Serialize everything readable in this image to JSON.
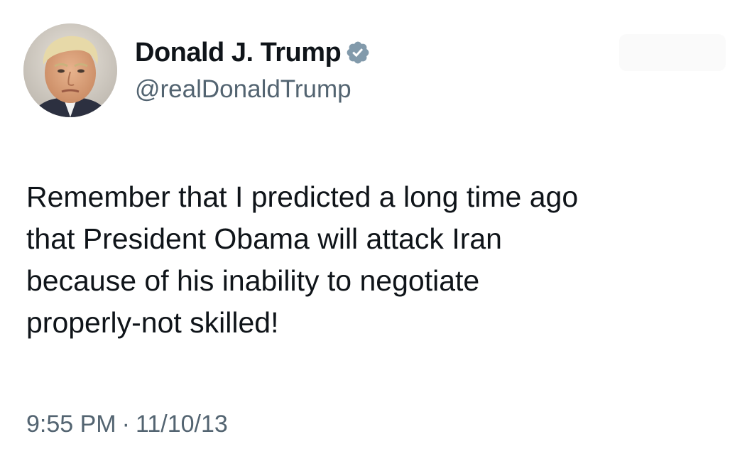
{
  "tweet": {
    "author": {
      "display_name": "Donald J. Trump",
      "handle": "@realDonaldTrump",
      "verified": true,
      "verified_icon": "verified-badge-icon",
      "verified_color": "#829aab"
    },
    "text_lines": [
      "Remember that I predicted a long time ago",
      "that President Obama will attack Iran",
      "because of his inability to negotiate",
      "properly-not skilled!"
    ],
    "time": "9:55 PM",
    "separator": "·",
    "date": "11/10/13"
  },
  "colors": {
    "text_primary": "#0f1419",
    "text_secondary": "#536471",
    "background": "#ffffff"
  }
}
